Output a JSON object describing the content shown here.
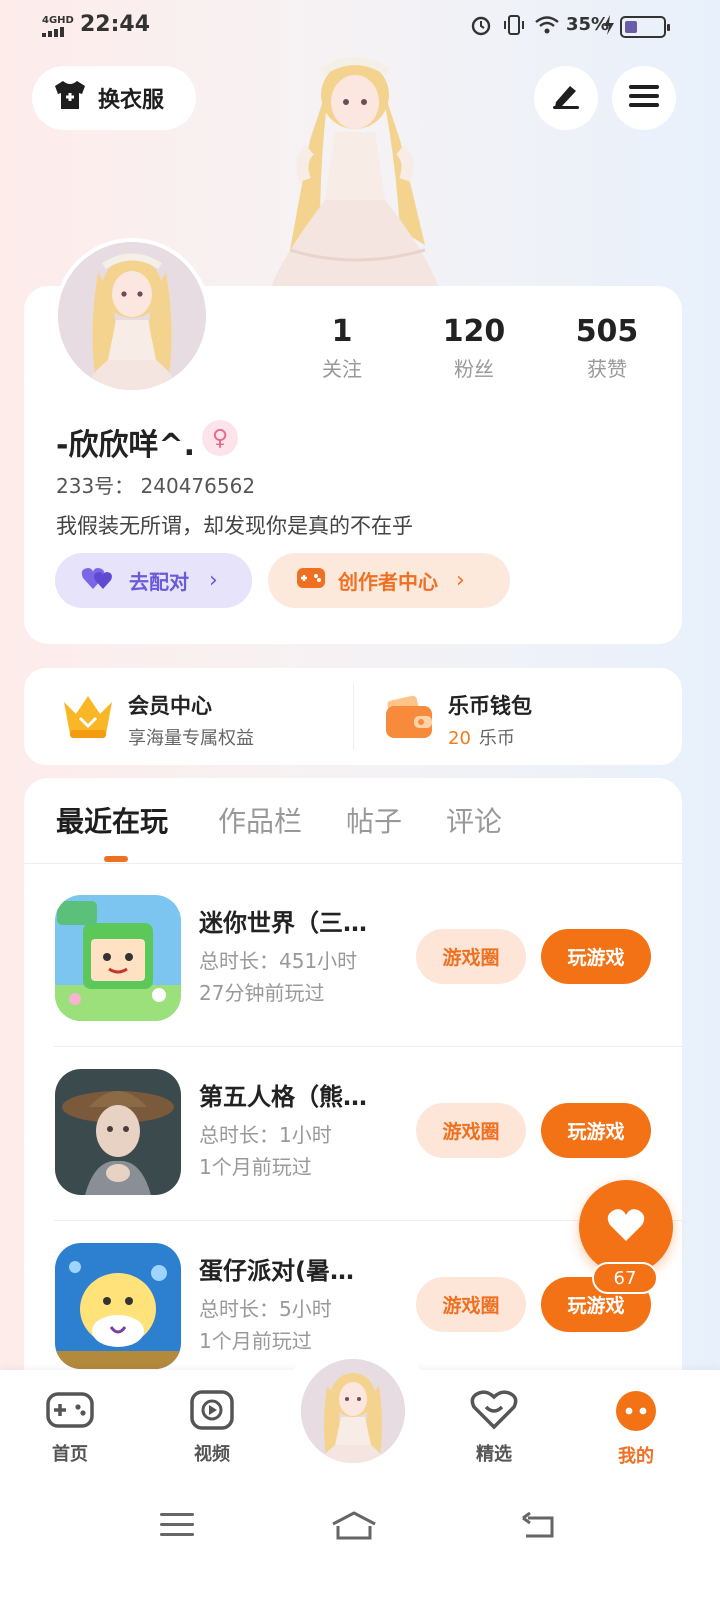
{
  "status_bar": {
    "network": "4GHD",
    "time": "22:44",
    "battery_percent": "35%"
  },
  "header": {
    "outfit_label": "换衣服"
  },
  "profile": {
    "stats": [
      {
        "value": "1",
        "label": "关注"
      },
      {
        "value": "120",
        "label": "粉丝"
      },
      {
        "value": "505",
        "label": "获赞"
      }
    ],
    "nickname": "-欣欣咩^.",
    "gender_symbol": "♀",
    "uid": "233号：  240476562",
    "bio": "我假装无所谓，却发现你是真的不在乎",
    "match_label": "去配对",
    "creator_label": "创作者中心"
  },
  "member": {
    "title": "会员中心",
    "subtitle": "享海量专属权益"
  },
  "wallet": {
    "title": "乐币钱包",
    "amount": "20",
    "unit": "乐币"
  },
  "tabs": [
    "最近在玩",
    "作品栏",
    "帖子",
    "评论"
  ],
  "games": [
    {
      "name": "迷你世界（三…",
      "duration": "总时长：451小时",
      "last_played": "27分钟前玩过",
      "circle_label": "游戏圈",
      "play_label": "玩游戏"
    },
    {
      "name": "第五人格（熊…",
      "duration": "总时长：1小时",
      "last_played": "1个月前玩过",
      "circle_label": "游戏圈",
      "play_label": "玩游戏"
    },
    {
      "name": "蛋仔派对(暑…",
      "duration": "总时长：5小时",
      "last_played": "1个月前玩过",
      "circle_label": "游戏圈",
      "play_label": "玩游戏"
    }
  ],
  "like_count": "67",
  "bottom_nav": [
    {
      "label": "首页",
      "icon": "gamepad-icon"
    },
    {
      "label": "视频",
      "icon": "video-icon"
    },
    {
      "label": "精选",
      "icon": "heart-badge-icon"
    },
    {
      "label": "我的",
      "icon": "profile-face-icon"
    }
  ],
  "colors": {
    "accent": "#f47216",
    "match_purple": "#6b5ad8"
  }
}
